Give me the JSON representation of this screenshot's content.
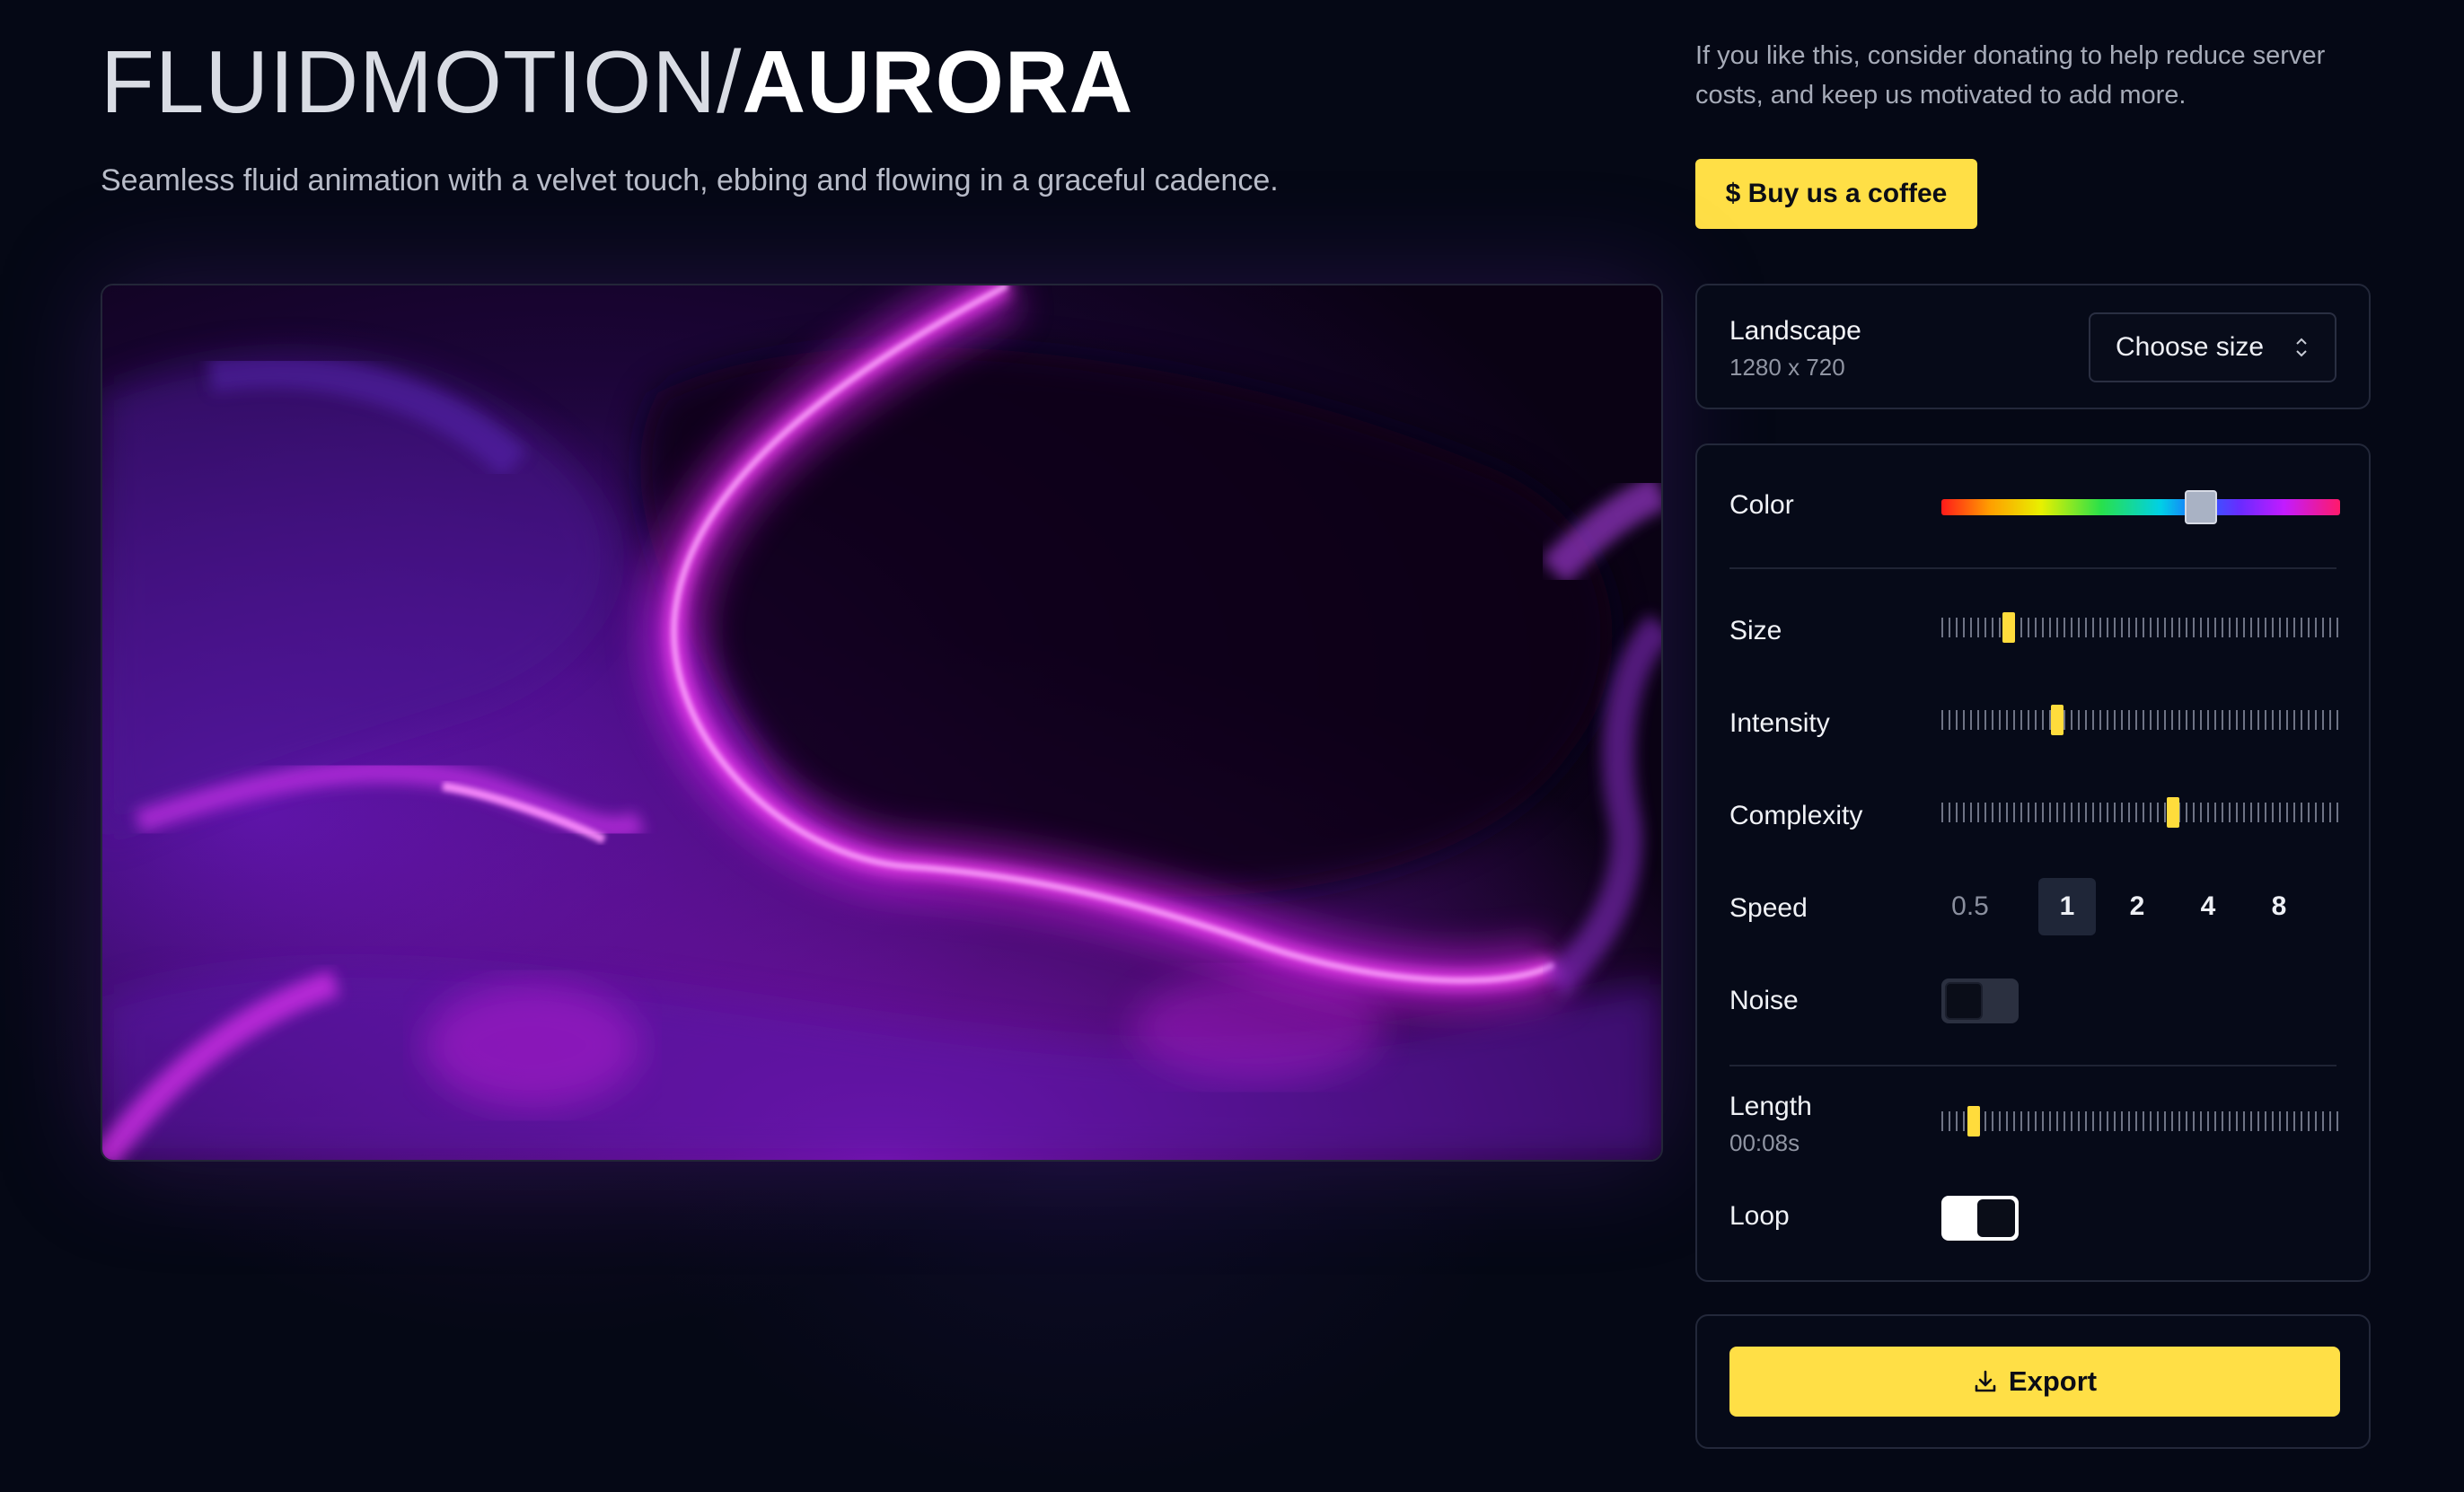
{
  "header": {
    "title_light": "FLUIDMOTION",
    "title_slash": "/",
    "title_bold": "AURORA",
    "subtitle": "Seamless fluid animation with a velvet touch, ebbing and flowing in a graceful cadence."
  },
  "donate": {
    "text": "If you like this, consider donating to help reduce server costs, and keep us motivated to add more.",
    "button_label": "$ Buy us a coffee"
  },
  "size_panel": {
    "label": "Landscape",
    "dimensions": "1280 x 720",
    "select_label": "Choose size"
  },
  "controls": {
    "color": {
      "label": "Color",
      "value_fraction": 0.65
    },
    "size": {
      "label": "Size",
      "value_fraction": 0.17
    },
    "intensity": {
      "label": "Intensity",
      "value_fraction": 0.29
    },
    "complexity": {
      "label": "Complexity",
      "value_fraction": 0.58
    },
    "speed": {
      "label": "Speed",
      "options": [
        "0.5",
        "1",
        "2",
        "4",
        "8"
      ],
      "selected": "1"
    },
    "noise": {
      "label": "Noise",
      "enabled": false
    },
    "length": {
      "label": "Length",
      "value": "00:08s",
      "value_fraction": 0.08
    },
    "loop": {
      "label": "Loop",
      "enabled": true
    }
  },
  "export": {
    "button_label": "Export"
  },
  "colors": {
    "accent": "#ffdf46",
    "background": "#050815",
    "panel_border": "#23283a"
  }
}
